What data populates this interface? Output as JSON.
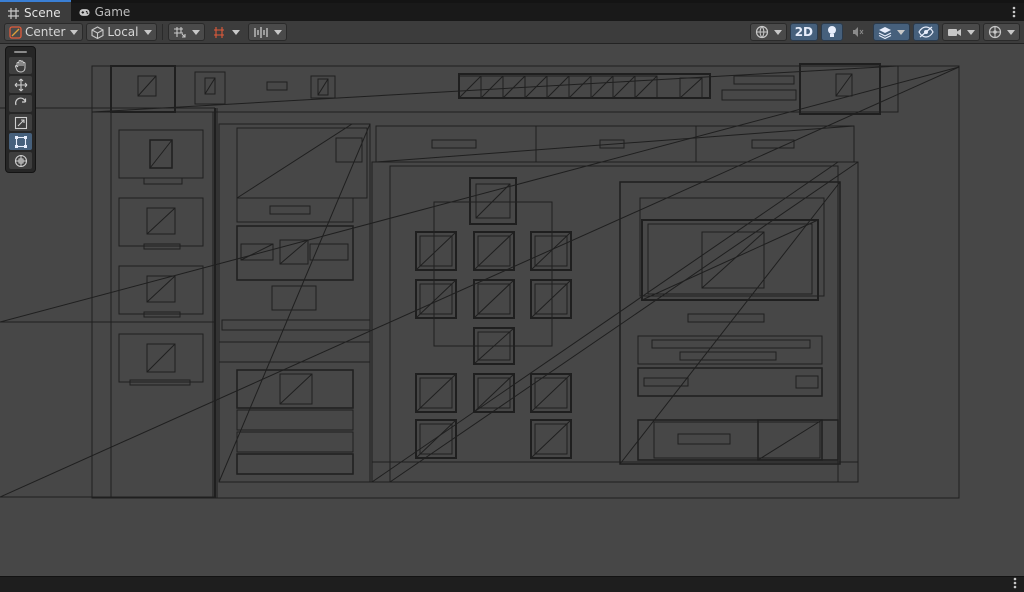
{
  "tabs": [
    {
      "label": "Scene",
      "icon": "grid-icon",
      "active": true
    },
    {
      "label": "Game",
      "icon": "gamepad-icon",
      "active": false
    }
  ],
  "toolbar": {
    "pivot_mode": "Center",
    "pivot_rotation": "Local",
    "view_2d_label": "2D"
  },
  "tools": [
    {
      "name": "hand-tool",
      "active": false
    },
    {
      "name": "move-tool",
      "active": false
    },
    {
      "name": "rotate-tool",
      "active": false
    },
    {
      "name": "scale-tool",
      "active": false
    },
    {
      "name": "rect-tool",
      "active": true
    },
    {
      "name": "transform-tool",
      "active": false
    }
  ],
  "colors": {
    "accent": "#46607c",
    "tab_highlight": "#3a7fd5",
    "scene_bg": "#474747",
    "toolbar_bg": "#3c3c3c",
    "wire": "#1a1a1a"
  }
}
